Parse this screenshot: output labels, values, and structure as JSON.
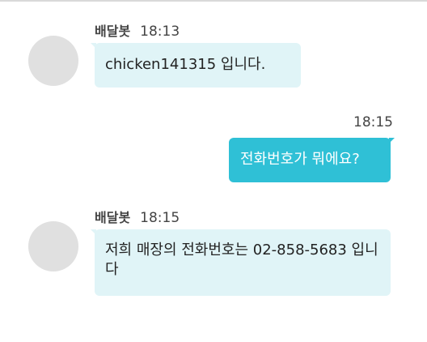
{
  "messages": [
    {
      "sender": "배달봇",
      "time": "18:13",
      "text": "chicken141315 입니다.",
      "side": "left"
    },
    {
      "time": "18:15",
      "text": "전화번호가 뭐에요?",
      "side": "right"
    },
    {
      "sender": "배달봇",
      "time": "18:15",
      "text": "저희 매장의 전화번호는 02-858-5683 입니다",
      "side": "left"
    }
  ],
  "colors": {
    "bot_bubble": "#e0f4f7",
    "user_bubble": "#2fc0d6",
    "avatar": "#e0e0e0"
  }
}
